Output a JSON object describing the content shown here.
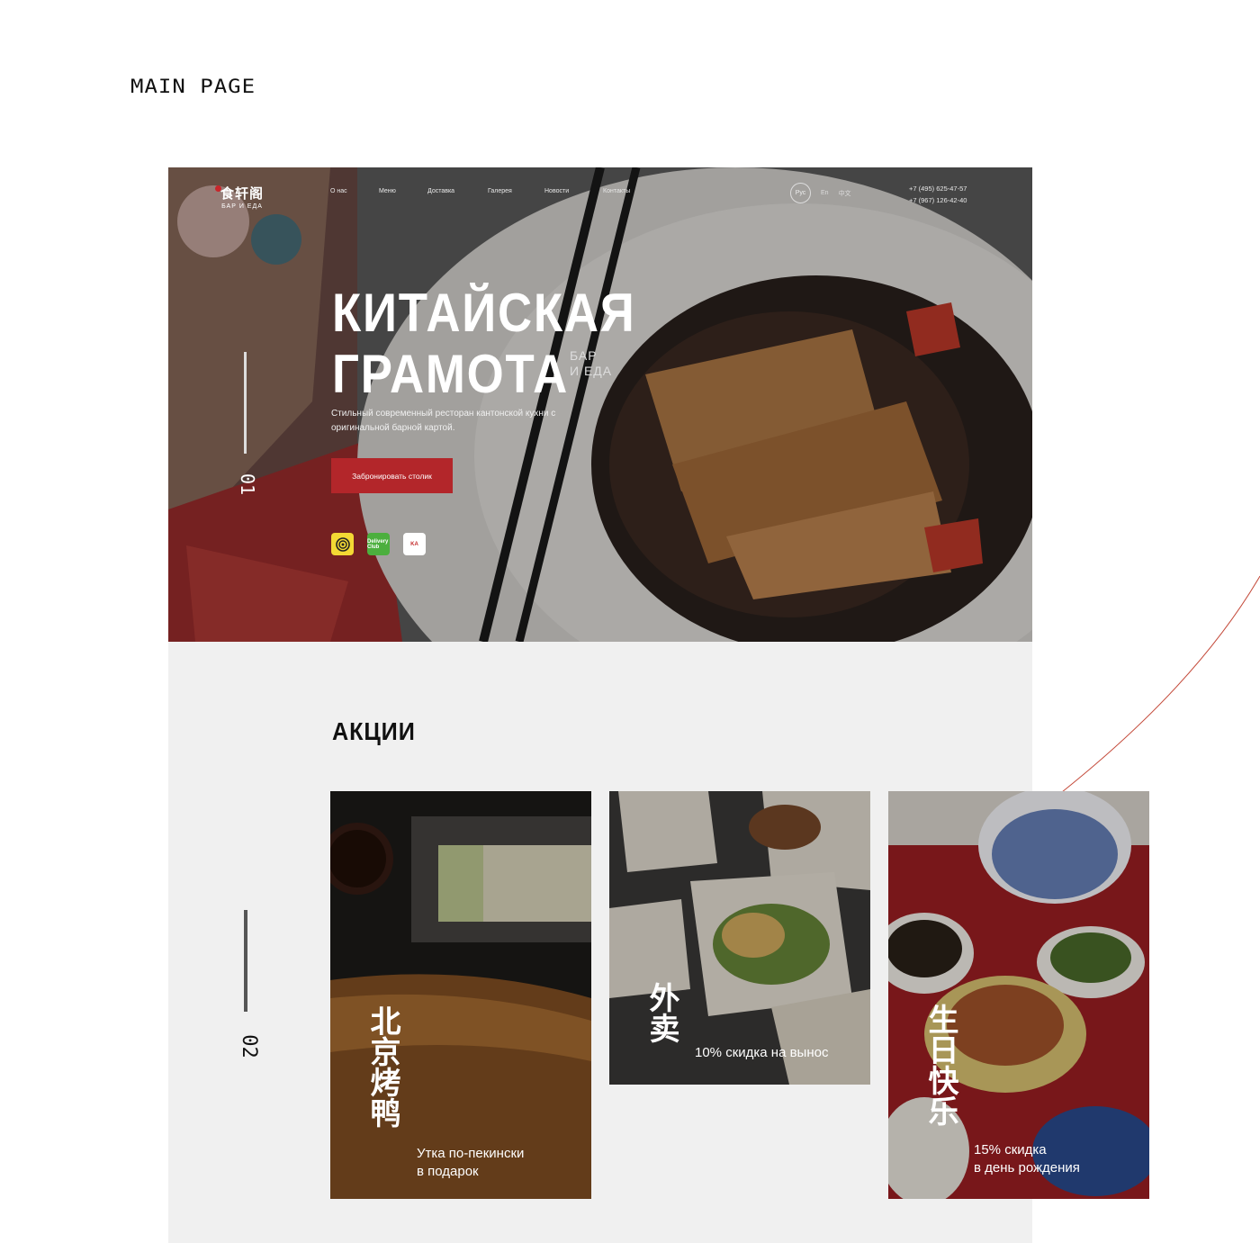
{
  "page_label": "MAIN PAGE",
  "header": {
    "logo_cn": "食轩阁",
    "logo_sub": "БАР И ЕДА",
    "nav": [
      "О нас",
      "Меню",
      "Доставка",
      "Галерея",
      "Новости",
      "Контакты"
    ],
    "languages": [
      "Рус",
      "En",
      "中文"
    ],
    "phones": [
      "+7 (495) 625-47-57",
      "+7 (967) 126-42-40"
    ]
  },
  "hero": {
    "title_line1": "КИТАЙСКАЯ",
    "title_line2": "ГРАМОТА",
    "tag_line1": "БАР",
    "tag_line2": "И ЕДА",
    "description": "Стильный современный ресторан кантонской кухни с оригинальной барной картой.",
    "book_button": "Забронировать столик",
    "slide_number": "01",
    "partners": [
      {
        "icon": "yandex-eda-icon",
        "color": "#f3d934"
      },
      {
        "icon": "delivery-club-icon",
        "label": "Delivery Club",
        "color": "#4caf3e"
      },
      {
        "icon": "kitchen-app-icon",
        "label": "KA",
        "color": "#ffffff"
      }
    ]
  },
  "promos": {
    "title": "АКЦИИ",
    "section_number": "02",
    "cards": [
      {
        "cn": "北京烤鸭",
        "text_line1": "Утка по-пекински",
        "text_line2": "в подарок"
      },
      {
        "cn": "外卖",
        "text_line1": "10% скидка на вынос",
        "text_line2": ""
      },
      {
        "cn": "生日快乐",
        "text_line1": "15% скидка",
        "text_line2": "в день рождения"
      }
    ]
  },
  "colors": {
    "accent_red": "#b3262a",
    "section_bg": "#f0f0f0"
  }
}
